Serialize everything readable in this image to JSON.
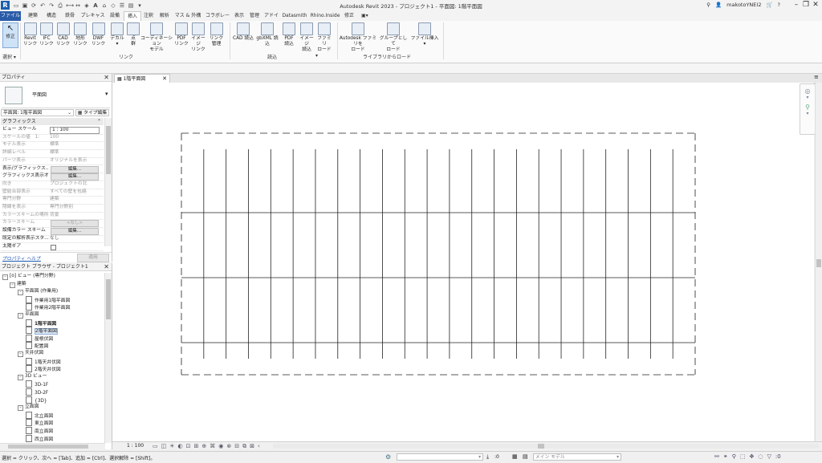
{
  "title_bar": {
    "title": "Autodesk Revit 2023 - プロジェクト1 - 平面図: 1階平面図",
    "username": "makotoYNEI2",
    "app_button": "R"
  },
  "tabs": [
    "ファイル",
    "建築",
    "構造",
    "鉄骨",
    "プレキャスト",
    "設備",
    "挿入",
    "注釈",
    "解析",
    "マス & 外構",
    "コラボレート",
    "表示",
    "管理",
    "アドイン",
    "Datasmith",
    "Rhino.Inside",
    "修正"
  ],
  "active_tab": "挿入",
  "ribbon": {
    "select": {
      "button": "修正",
      "panel": "選択 ▾"
    },
    "link_panel": "リンク",
    "link_buttons": [
      "Revit\nリンク",
      "IFC\nリンク",
      "CAD\nリンク",
      "地形\nリンク",
      "DWF\nリンク",
      "デカル\n▾",
      "点\n群",
      "コーディネーション\nモデル",
      "PDF\nリンク",
      "イメージ\nリンク",
      "リンク\n管理"
    ],
    "import_panel": "読込",
    "import_buttons": [
      "CAD 読込",
      "gbXML 読込",
      "PDF\n読込",
      "イメージ\n読込",
      "ファミリ\nロード"
    ],
    "library_panel": "ライブラリからロード",
    "library_buttons": [
      "Autodesk ファミリを\nロード",
      "グループとして\nロード",
      "ファイル挿入\n▾"
    ]
  },
  "properties": {
    "header": "プロパティ",
    "type_name": "平面図",
    "instance_selector": "平面図: 1階平面図",
    "edit_type": "タイプ編集",
    "section": "グラフィックス",
    "rows": [
      {
        "k": "ビュー スケール",
        "v": "1 : 100",
        "kind": "input"
      },
      {
        "k": "スケールの値　1:",
        "v": "100",
        "kind": "grey"
      },
      {
        "k": "モデル表示",
        "v": "標準",
        "kind": "grey"
      },
      {
        "k": "詳細レベル",
        "v": "標準",
        "kind": "grey"
      },
      {
        "k": "パーツ表示",
        "v": "オリジナルを表示",
        "kind": "grey"
      },
      {
        "k": "表示/グラフィックス...",
        "v": "編集...",
        "kind": "button"
      },
      {
        "k": "グラフィックス表示オ...",
        "v": "編集...",
        "kind": "button"
      },
      {
        "k": "向き",
        "v": "プロジェクトの北",
        "kind": "grey"
      },
      {
        "k": "壁結合部表示",
        "v": "すべての壁を包絡",
        "kind": "grey"
      },
      {
        "k": "専門分野",
        "v": "建築",
        "kind": "grey"
      },
      {
        "k": "隠線を表示",
        "v": "専門分野別",
        "kind": "grey"
      },
      {
        "k": "カラースキームの場所",
        "v": "背景",
        "kind": "grey"
      },
      {
        "k": "カラースキーム",
        "v": "<なし>",
        "kind": "greybutton"
      },
      {
        "k": "設備カラー スキーム",
        "v": "編集...",
        "kind": "button"
      },
      {
        "k": "既定の解析表示スタ...",
        "v": "なし",
        "kind": "plain"
      },
      {
        "k": "太陽ギア",
        "v": "",
        "kind": "check"
      }
    ],
    "help_link": "プロパティ ヘルプ",
    "apply": "適用"
  },
  "browser": {
    "header": "プロジェクト ブラウザ - プロジェクト1",
    "nodes": [
      {
        "t": "[o] ビュー (専門分野)",
        "lvl": 0,
        "box": "minus"
      },
      {
        "t": "建築",
        "lvl": 1,
        "box": "minus"
      },
      {
        "t": "平面図 (作業用)",
        "lvl": 2,
        "box": "minus"
      },
      {
        "t": "作業用1階平面図",
        "lvl": 3,
        "box": "page"
      },
      {
        "t": "作業用2階平面図",
        "lvl": 3,
        "box": "page"
      },
      {
        "t": "平面図",
        "lvl": 2,
        "box": "minus"
      },
      {
        "t": "1階平面図",
        "lvl": 3,
        "box": "page",
        "bold": true
      },
      {
        "t": "2階平面図",
        "lvl": 3,
        "box": "page",
        "sel": true
      },
      {
        "t": "屋根伏図",
        "lvl": 3,
        "box": "page"
      },
      {
        "t": "配置図",
        "lvl": 3,
        "box": "page"
      },
      {
        "t": "天井伏図",
        "lvl": 2,
        "box": "minus"
      },
      {
        "t": "1階天井伏図",
        "lvl": 3,
        "box": "page"
      },
      {
        "t": "2階天井伏図",
        "lvl": 3,
        "box": "page"
      },
      {
        "t": "3D ビュー",
        "lvl": 2,
        "box": "minus"
      },
      {
        "t": "3D-1F",
        "lvl": 3,
        "box": "page"
      },
      {
        "t": "3D-2F",
        "lvl": 3,
        "box": "page"
      },
      {
        "t": "{3D}",
        "lvl": 3,
        "box": "page"
      },
      {
        "t": "立面図",
        "lvl": 2,
        "box": "minus"
      },
      {
        "t": "北立面図",
        "lvl": 3,
        "box": "page"
      },
      {
        "t": "東立面図",
        "lvl": 3,
        "box": "page"
      },
      {
        "t": "南立面図",
        "lvl": 3,
        "box": "page"
      },
      {
        "t": "西立面図",
        "lvl": 3,
        "box": "page"
      }
    ]
  },
  "view_tab": "1階平面図",
  "view_scale": "1 : 100",
  "status": {
    "hint": "選択 = クリック、次へ = [Tab]、追加 = [Ctrl]、選択解除 = [Shift]。",
    "zero": ":0",
    "model": "メイン モデル",
    "filter_count": ":0"
  }
}
